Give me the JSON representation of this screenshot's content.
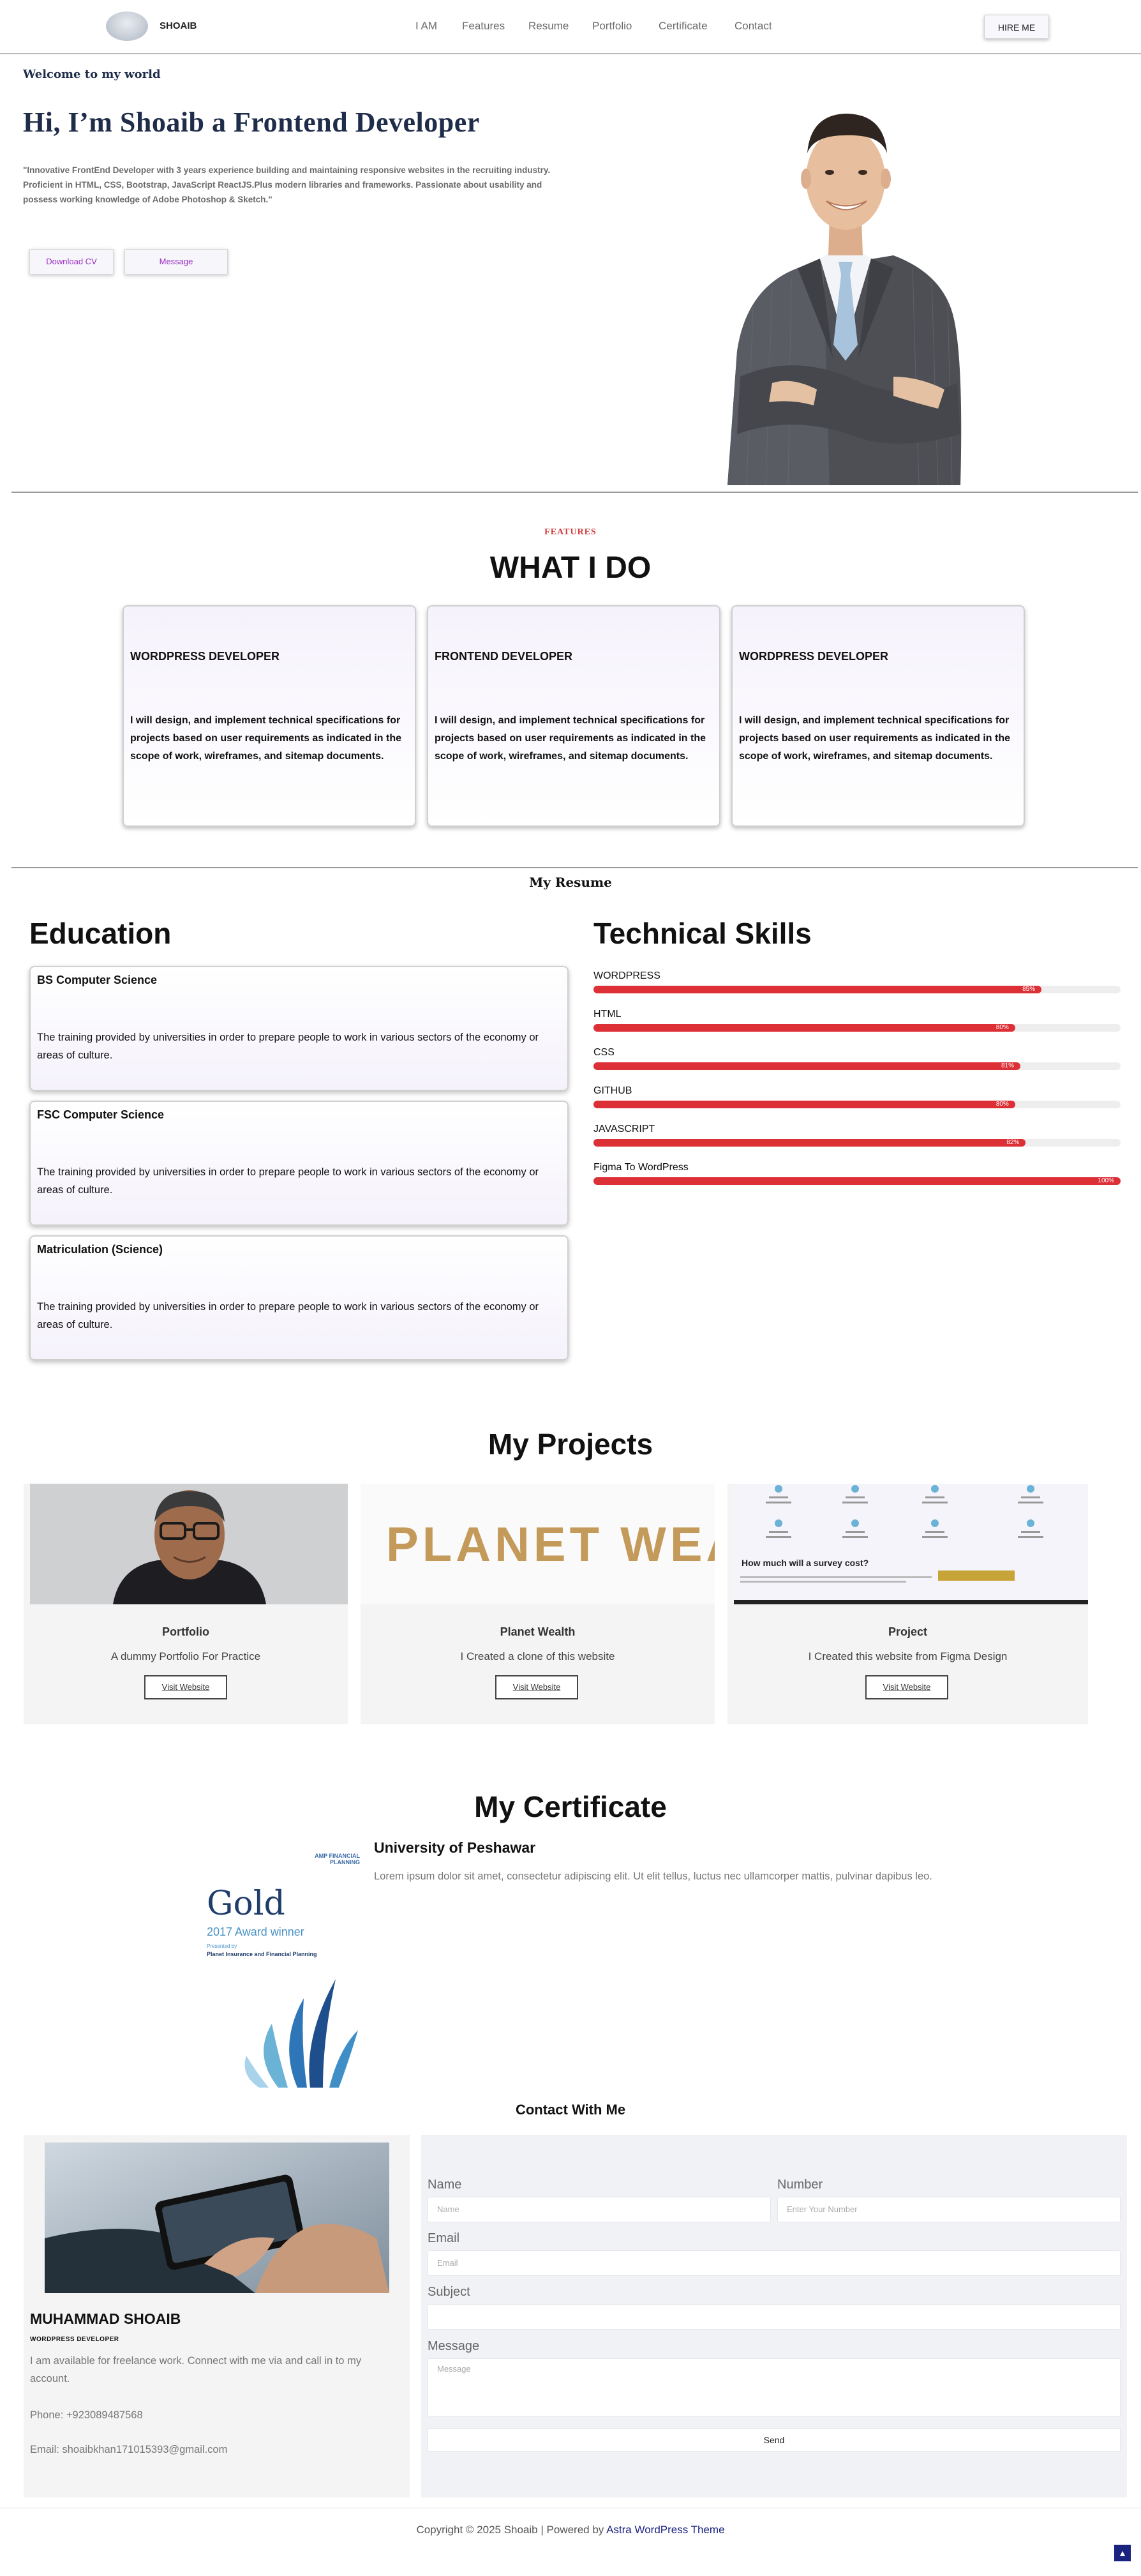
{
  "header": {
    "logo_text": "SHOAIB",
    "nav": [
      "I AM",
      "Features",
      "Resume",
      "Portfolio",
      "Certificate",
      "Contact"
    ],
    "hire_label": "HIRE ME"
  },
  "hero": {
    "welcome": "Welcome to my world",
    "title": "Hi, I’m Shoaib a Frontend Developer",
    "description": "\"Innovative FrontEnd Developer with 3 years experience building and maintaining responsive websites in the recruiting industry. Proficient in HTML, CSS, Bootstrap, JavaScript ReactJS.Plus modern libraries and frameworks. Passionate about usability and possess working knowledge of Adobe Photoshop & Sketch.\"",
    "download_label": "Download CV",
    "message_label": "Message"
  },
  "features": {
    "label": "FEATURES",
    "title": "WHAT I DO",
    "cards": [
      {
        "title": "WORDPRESS DEVELOPER",
        "text": "I will design, and implement technical specifications for projects based on user requirements as indicated in the scope of work, wireframes, and sitemap documents."
      },
      {
        "title": "FRONTEND DEVELOPER",
        "text": "I will design, and implement technical specifications for projects based on user requirements as indicated in the scope of work, wireframes, and sitemap documents."
      },
      {
        "title": "WORDPRESS DEVELOPER",
        "text": "I will design, and implement technical specifications for projects based on user requirements as indicated in the scope of work, wireframes, and sitemap documents."
      }
    ]
  },
  "resume": {
    "title": "My Resume",
    "education_heading": "Education",
    "skills_heading": "Technical Skills",
    "education": [
      {
        "title": "BS Computer Science",
        "text": "The training provided by universities in order to prepare people to work in various sectors of the economy or areas of culture."
      },
      {
        "title": "FSC Computer Science",
        "text": "The training provided by universities in order to prepare people to work in various sectors of the economy or areas of culture."
      },
      {
        "title": "Matriculation (Science)",
        "text": "The training provided by universities in order to prepare people to work in various sectors of the economy or areas of culture."
      }
    ],
    "skills": [
      {
        "name": "WORDPRESS",
        "percent": 85,
        "label": "85%"
      },
      {
        "name": "HTML",
        "percent": 80,
        "label": "80%"
      },
      {
        "name": "CSS",
        "percent": 81,
        "label": "81%"
      },
      {
        "name": "GITHUB",
        "percent": 80,
        "label": "80%"
      },
      {
        "name": "JAVASCRIPT",
        "percent": 82,
        "label": "82%"
      },
      {
        "name": "Figma To WordPress",
        "percent": 100,
        "label": "100%"
      }
    ]
  },
  "projects": {
    "title": "My Projects",
    "items": [
      {
        "title": "Portfolio",
        "subtitle": "A dummy Portfolio For Practice",
        "button": "Visit Website"
      },
      {
        "title": "Planet Wealth",
        "subtitle": "I Created a clone of this website",
        "button": "Visit Website",
        "image_text": "PLANET WEA"
      },
      {
        "title": "Project",
        "subtitle": "I Created this website from Figma Design",
        "button": "Visit Website",
        "image_heading": "How much will a survey cost?"
      }
    ]
  },
  "certificate": {
    "title": "My Certificate",
    "university": "University of Peshawar",
    "description": "Lorem ipsum dolor sit amet, consectetur adipiscing elit. Ut elit tellus, luctus nec ullamcorper mattis, pulvinar dapibus leo.",
    "image": {
      "brand": "AMP FINANCIAL PLANNING",
      "gold": "Gold",
      "award": "2017 Award winner",
      "presented": "Presented by",
      "category": "Planet Insurance and Financial Planning"
    }
  },
  "contact": {
    "title": "Contact With Me",
    "name": "MUHAMMAD SHOAIB",
    "role": "WORDPRESS DEVELOPER",
    "about": "I am available for freelance work. Connect with me via and call in to my account.",
    "phone": "Phone: +923089487568",
    "email": "Email: shoaibkhan171015393@gmail.com",
    "form": {
      "name_label": "Name",
      "name_placeholder": "Name",
      "number_label": "Number",
      "number_placeholder": "Enter Your Number",
      "email_label": "Email",
      "email_placeholder": "Email",
      "subject_label": "Subject",
      "message_label": "Message",
      "message_placeholder": "Message",
      "send_label": "Send"
    }
  },
  "footer": {
    "copyright": "Copyright © 2025 Shoaib | Powered by ",
    "link": "Astra WordPress Theme"
  },
  "colors": {
    "accent": "#dc2f36",
    "heading": "#1f2d4a",
    "link": "#1a237e"
  }
}
